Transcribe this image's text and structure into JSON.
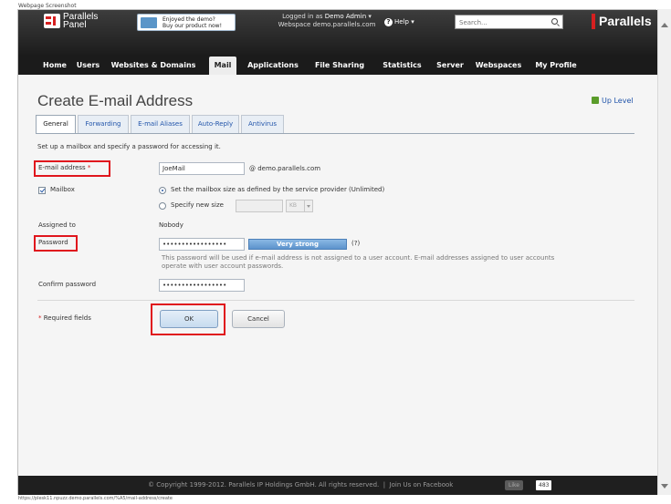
{
  "screenshot_label": "Webpage Screenshot",
  "status_url": "https://plesk11.npuzz.demo.parallels.com/%A5/mail-address/create",
  "header": {
    "logo_line1": "Parallels",
    "logo_line2": "Panel",
    "promo_line1": "Enjoyed the demo?",
    "promo_line2": "Buy our product now!",
    "logged_in_prefix": "Logged in as",
    "user": "Demo Admin",
    "webspace_prefix": "Webspace",
    "webspace": "demo.parallels.com",
    "help_label": "Help",
    "search_placeholder": "Search...",
    "brand": "Parallels"
  },
  "nav": {
    "tabs": [
      {
        "label": "Home"
      },
      {
        "label": "Users"
      },
      {
        "label": "Websites & Domains"
      },
      {
        "label": "Mail"
      },
      {
        "label": "Applications"
      },
      {
        "label": "File Sharing"
      },
      {
        "label": "Statistics"
      },
      {
        "label": "Server"
      },
      {
        "label": "Webspaces"
      },
      {
        "label": "My Profile"
      }
    ],
    "active": "Mail"
  },
  "page": {
    "title": "Create E-mail Address",
    "up_level": "Up Level",
    "tabs": [
      {
        "label": "General"
      },
      {
        "label": "Forwarding"
      },
      {
        "label": "E-mail Aliases"
      },
      {
        "label": "Auto-Reply"
      },
      {
        "label": "Antivirus"
      }
    ],
    "active_tab": "General",
    "intro": "Set up a mailbox and specify a password for accessing it."
  },
  "form": {
    "email_label": "E-mail address",
    "email_required_mark": "*",
    "email_value": "JoeMail",
    "email_domain": "@ demo.parallels.com",
    "mailbox_label": "Mailbox",
    "mailbox_checked": true,
    "size_option_default": "Set the mailbox size as defined by the service provider (Unlimited)",
    "size_option_custom": "Specify new size",
    "size_unit": "KB",
    "assigned_label": "Assigned to",
    "assigned_value": "Nobody",
    "password_label": "Password",
    "password_value": "•••••••••••••••••",
    "strength_label": "Very strong",
    "strength_help": "(?)",
    "password_hint_line1": "This password will be used if e-mail address is not assigned to a user account. E-mail addresses assigned to user accounts",
    "password_hint_line2": "operate with user account passwords.",
    "confirm_label": "Confirm password",
    "confirm_value": "•••••••••••••••••",
    "required_mark": "*",
    "required_note": "Required fields",
    "ok_label": "OK",
    "cancel_label": "Cancel"
  },
  "footer": {
    "copyright": "© Copyright 1999-2012. Parallels IP Holdings GmbH. All rights reserved.",
    "separator": "|",
    "facebook": "Join Us on Facebook",
    "like_label": "Like",
    "like_count": "483"
  },
  "colors": {
    "highlight_red": "#e0161d",
    "link_blue": "#2255aa",
    "brand_red": "#d62020"
  }
}
